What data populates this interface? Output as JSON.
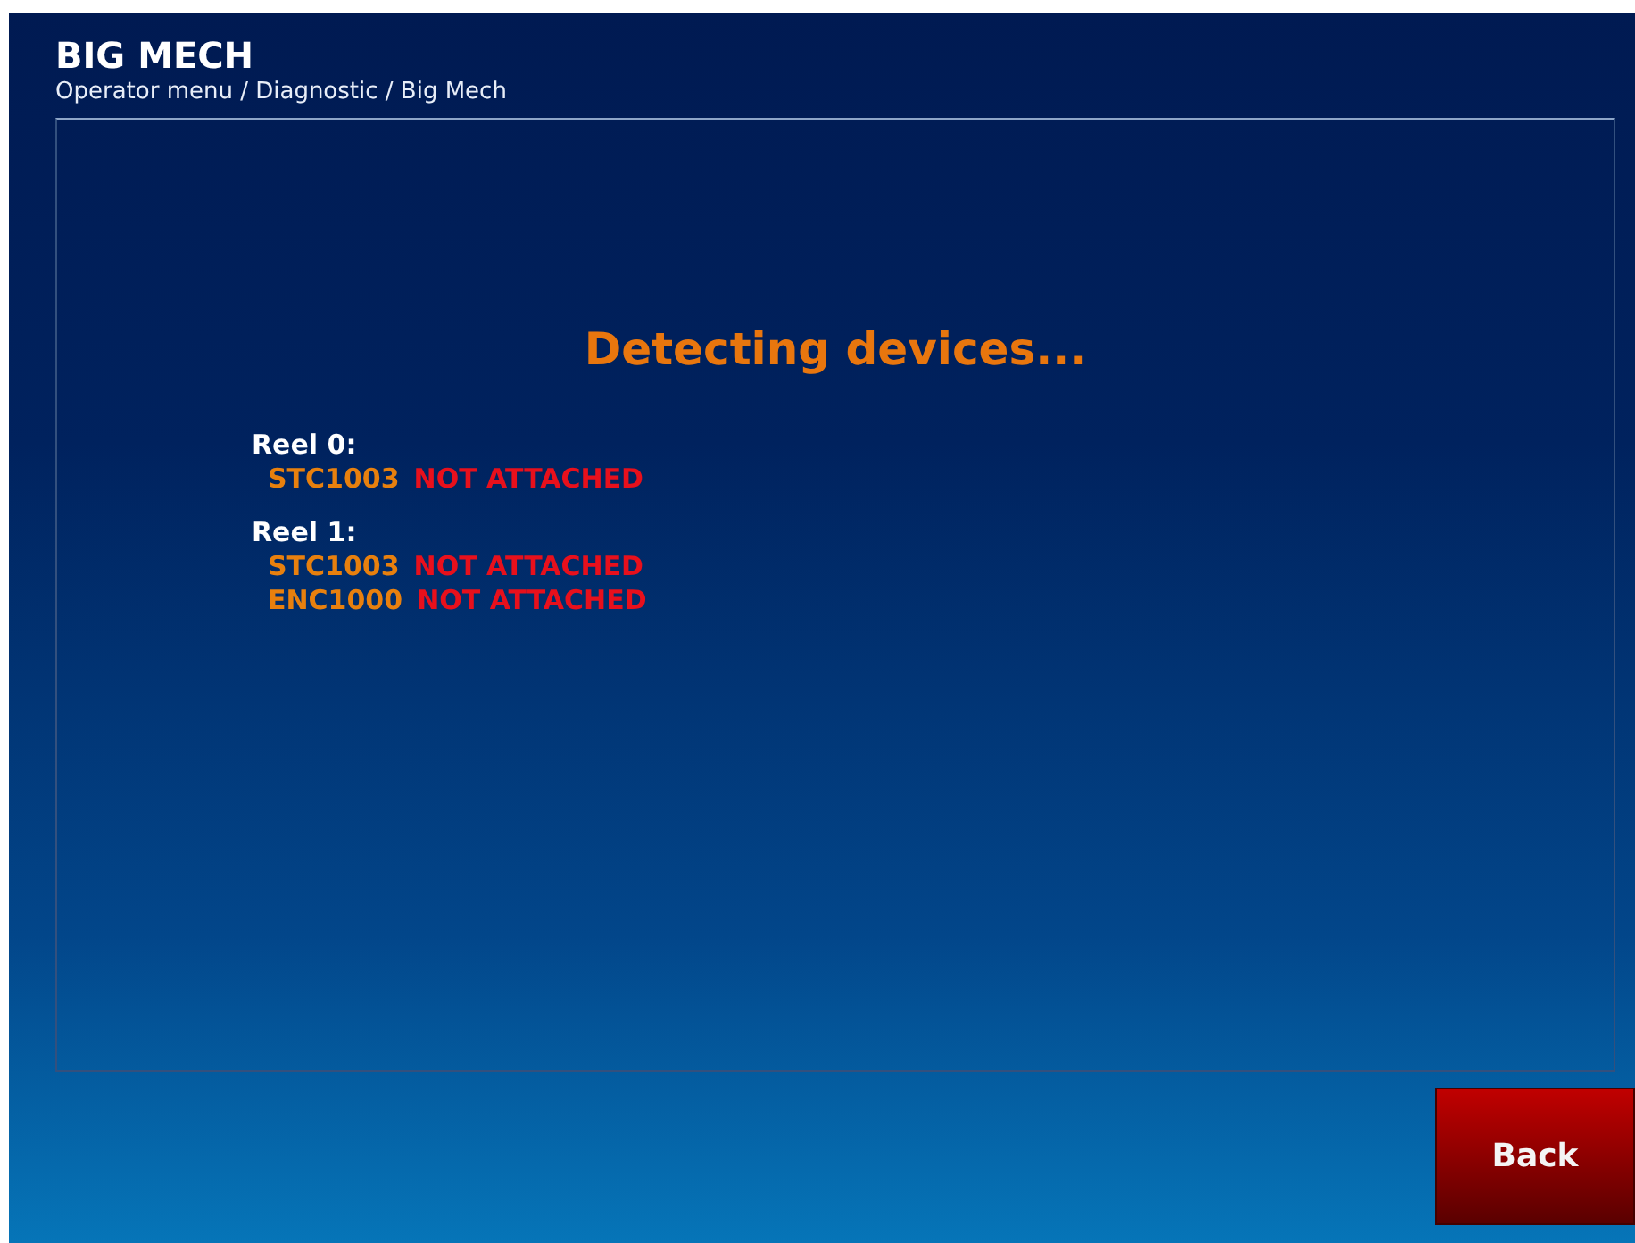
{
  "header": {
    "title": "BIG MECH",
    "breadcrumb": "Operator menu / Diagnostic / Big Mech"
  },
  "message": "Detecting devices...",
  "reels": [
    {
      "label": "Reel 0:",
      "devices": [
        {
          "name": "STC1003",
          "status": "NOT ATTACHED",
          "attached": false
        }
      ]
    },
    {
      "label": "Reel 1:",
      "devices": [
        {
          "name": "STC1003",
          "status": "NOT ATTACHED",
          "attached": false
        },
        {
          "name": "ENC1000",
          "status": "NOT ATTACHED",
          "attached": false
        }
      ]
    }
  ],
  "back_button": "Back"
}
